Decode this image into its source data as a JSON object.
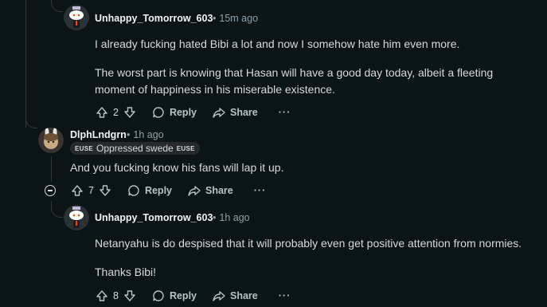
{
  "comments": [
    {
      "username": "Unhappy_Tomorrow_603",
      "time": "15m ago",
      "paragraphs": [
        "I already fucking hated Bibi a lot and now I somehow hate him even more.",
        "The worst part is knowing that Hasan will have a good day today, albeit a fleeting moment of happiness in his miserable existence."
      ],
      "votes": "2",
      "reply_label": "Reply",
      "share_label": "Share",
      "more_label": "···"
    },
    {
      "username": "DlphLndgrn",
      "time": "1h ago",
      "flair": {
        "left_tag": "EUSE",
        "text": "Oppressed swede",
        "right_tag": "EUSE"
      },
      "paragraphs": [
        "And you fucking know his fans will lap it up."
      ],
      "votes": "7",
      "reply_label": "Reply",
      "share_label": "Share",
      "more_label": "···"
    },
    {
      "username": "Unhappy_Tomorrow_603",
      "time": "1h ago",
      "paragraphs": [
        "Netanyahu is do despised that it will probably even get positive attention from normies.",
        "Thanks Bibi!"
      ],
      "votes": "8",
      "reply_label": "Reply",
      "share_label": "Share",
      "more_label": "···"
    }
  ],
  "separator": "•",
  "colors": {
    "background": "#0b1416",
    "text": "#d7dadc",
    "muted": "#8ba2ad",
    "thread": "#343536"
  }
}
